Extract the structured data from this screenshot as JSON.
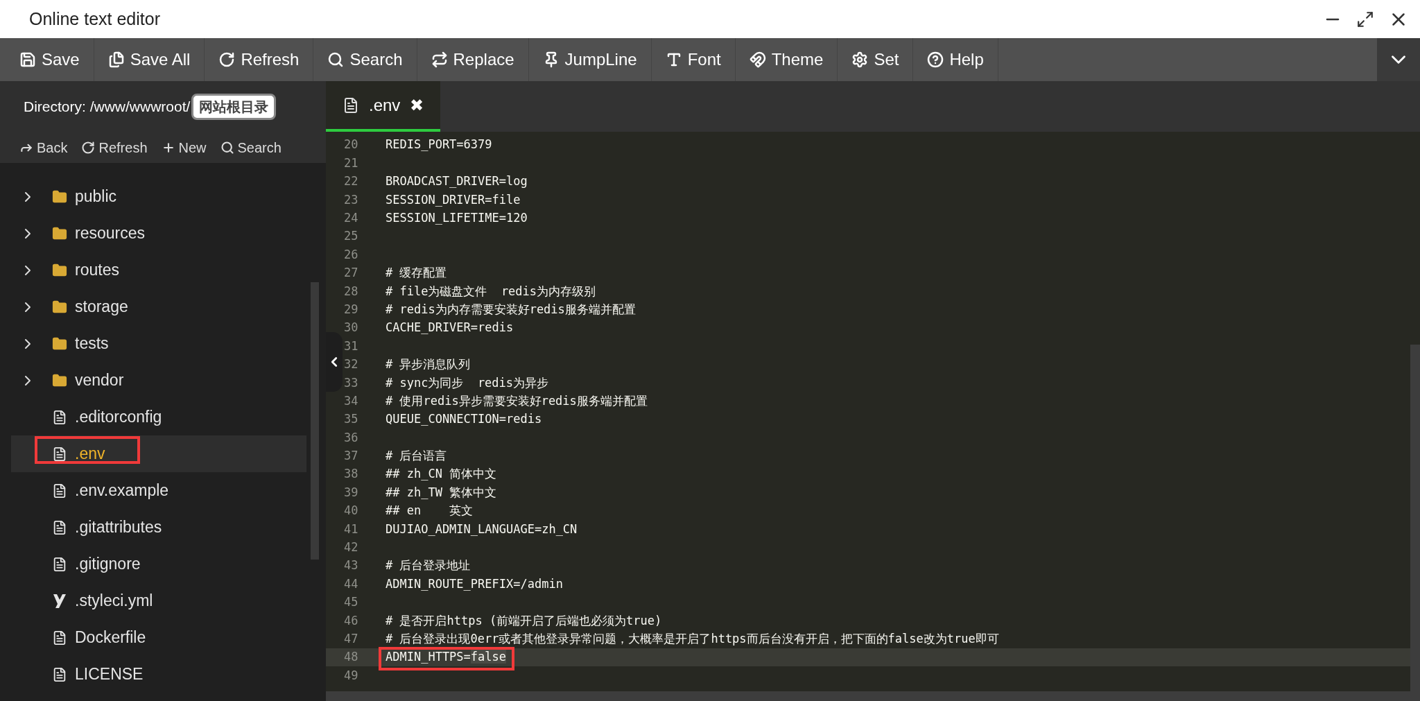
{
  "window": {
    "title": "Online text editor"
  },
  "toolbar": [
    {
      "label": "Save",
      "kind": "save"
    },
    {
      "label": "Save All",
      "kind": "saveall"
    },
    {
      "label": "Refresh",
      "kind": "refresh"
    },
    {
      "label": "Search",
      "kind": "search"
    },
    {
      "label": "Replace",
      "kind": "replace"
    },
    {
      "label": "JumpLine",
      "kind": "jump"
    },
    {
      "label": "Font",
      "kind": "font"
    },
    {
      "label": "Theme",
      "kind": "theme"
    },
    {
      "label": "Set",
      "kind": "settings"
    },
    {
      "label": "Help",
      "kind": "help"
    }
  ],
  "sidebar": {
    "directory": "Directory: /www/wwwroot/",
    "badge": "网站根目录",
    "actions": [
      {
        "label": "Back",
        "kind": "back"
      },
      {
        "label": "Refresh",
        "kind": "refresh"
      },
      {
        "label": "New",
        "kind": "new"
      },
      {
        "label": "Search",
        "kind": "search"
      }
    ],
    "items": [
      {
        "name": "public",
        "kind": "folder",
        "selected": false,
        "annotated": false
      },
      {
        "name": "resources",
        "kind": "folder",
        "selected": false,
        "annotated": false
      },
      {
        "name": "routes",
        "kind": "folder",
        "selected": false,
        "annotated": false
      },
      {
        "name": "storage",
        "kind": "folder",
        "selected": false,
        "annotated": false
      },
      {
        "name": "tests",
        "kind": "folder",
        "selected": false,
        "annotated": false
      },
      {
        "name": "vendor",
        "kind": "folder",
        "selected": false,
        "annotated": false
      },
      {
        "name": ".editorconfig",
        "kind": "file",
        "selected": false,
        "annotated": false
      },
      {
        "name": ".env",
        "kind": "file",
        "selected": true,
        "annotated": true
      },
      {
        "name": ".env.example",
        "kind": "file",
        "selected": false,
        "annotated": false
      },
      {
        "name": ".gitattributes",
        "kind": "file",
        "selected": false,
        "annotated": false
      },
      {
        "name": ".gitignore",
        "kind": "file",
        "selected": false,
        "annotated": false
      },
      {
        "name": ".styleci.yml",
        "kind": "yaml",
        "selected": false,
        "annotated": false
      },
      {
        "name": "Dockerfile",
        "kind": "file",
        "selected": false,
        "annotated": false
      },
      {
        "name": "LICENSE",
        "kind": "file",
        "selected": false,
        "annotated": false
      }
    ]
  },
  "tabs": [
    {
      "label": ".env",
      "selected": true,
      "close": "✖"
    }
  ],
  "editor": {
    "lines": [
      {
        "number": "20",
        "text": "REDIS_PORT=6379"
      },
      {
        "number": "21"
      },
      {
        "number": "22",
        "text": "BROADCAST_DRIVER=log"
      },
      {
        "number": "23",
        "text": "SESSION_DRIVER=file"
      },
      {
        "number": "24",
        "text": "SESSION_LIFETIME=120"
      },
      {
        "number": "25"
      },
      {
        "number": "26"
      },
      {
        "number": "27",
        "text": "# 缓存配置"
      },
      {
        "number": "28",
        "text": "# file为磁盘文件  redis为内存级别"
      },
      {
        "number": "29",
        "text": "# redis为内存需要安装好redis服务端并配置"
      },
      {
        "number": "30",
        "text": "CACHE_DRIVER=redis"
      },
      {
        "number": "31"
      },
      {
        "number": "32",
        "text": "# 异步消息队列"
      },
      {
        "number": "33",
        "text": "# sync为同步  redis为异步"
      },
      {
        "number": "34",
        "text": "# 使用redis异步需要安装好redis服务端并配置"
      },
      {
        "number": "35",
        "text": "QUEUE_CONNECTION=redis"
      },
      {
        "number": "36"
      },
      {
        "number": "37",
        "text": "# 后台语言"
      },
      {
        "number": "38",
        "text": "## zh_CN 简体中文"
      },
      {
        "number": "39",
        "text": "## zh_TW 繁体中文"
      },
      {
        "number": "40",
        "text": "## en    英文"
      },
      {
        "number": "41",
        "text": "DUJIAO_ADMIN_LANGUAGE=zh_CN"
      },
      {
        "number": "42"
      },
      {
        "number": "43",
        "text": "# 后台登录地址"
      },
      {
        "number": "44",
        "text": "ADMIN_ROUTE_PREFIX=/admin"
      },
      {
        "number": "45"
      },
      {
        "number": "46",
        "text": "# 是否开启https (前端开启了后端也必须为true)"
      },
      {
        "number": "47",
        "text": "# 后台登录出现0err或者其他登录异常问题，大概率是开启了https而后台没有开启，把下面的false改为true即可"
      },
      {
        "number": "48",
        "text": "ADMIN_HTTPS=",
        "selection": "false",
        "active": true,
        "annotated": true
      },
      {
        "number": "49"
      }
    ]
  }
}
